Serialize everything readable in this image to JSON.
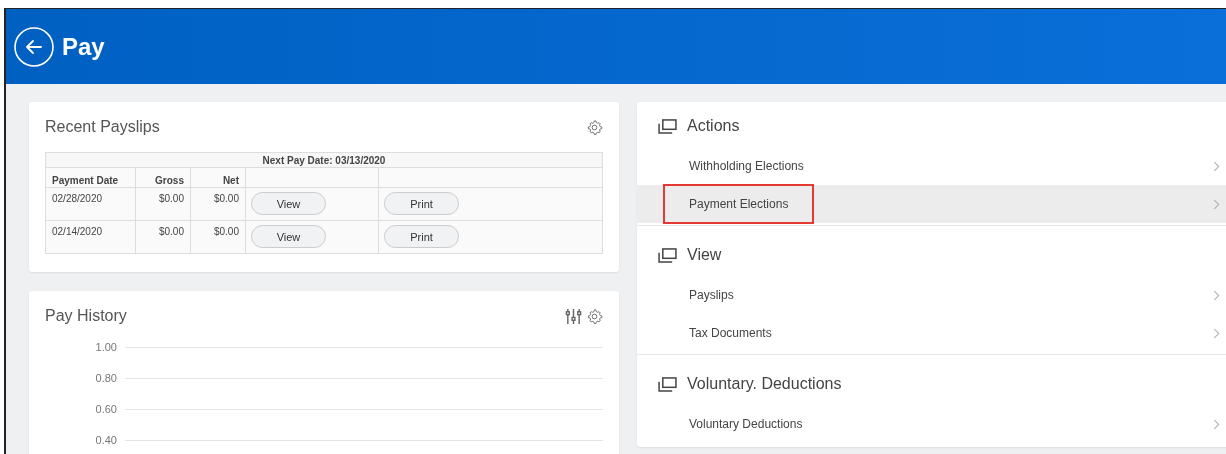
{
  "header": {
    "title": "Pay"
  },
  "recent_payslips": {
    "title": "Recent Payslips",
    "table": {
      "caption": "Next Pay Date: 03/13/2020",
      "columns": [
        "Payment Date",
        "Gross",
        "Net"
      ],
      "rows": [
        {
          "date": "02/28/2020",
          "gross": "$0.00",
          "net": "$0.00",
          "view": "View",
          "print": "Print"
        },
        {
          "date": "02/14/2020",
          "gross": "$0.00",
          "net": "$0.00",
          "view": "View",
          "print": "Print"
        }
      ]
    }
  },
  "pay_history": {
    "title": "Pay History",
    "axis_labels": [
      "1.00",
      "0.80",
      "0.60",
      "0.40"
    ]
  },
  "sections": [
    {
      "title": "Actions",
      "items": [
        {
          "label": "Withholding Elections",
          "selected": false,
          "marked": false
        },
        {
          "label": "Payment Elections",
          "selected": true,
          "marked": true
        }
      ]
    },
    {
      "title": "View",
      "items": [
        {
          "label": "Payslips",
          "selected": false,
          "marked": false
        },
        {
          "label": "Tax Documents",
          "selected": false,
          "marked": false
        }
      ]
    },
    {
      "title": "Voluntary. Deductions",
      "items": [
        {
          "label": "Voluntary Deductions",
          "selected": false,
          "marked": false
        }
      ]
    }
  ]
}
